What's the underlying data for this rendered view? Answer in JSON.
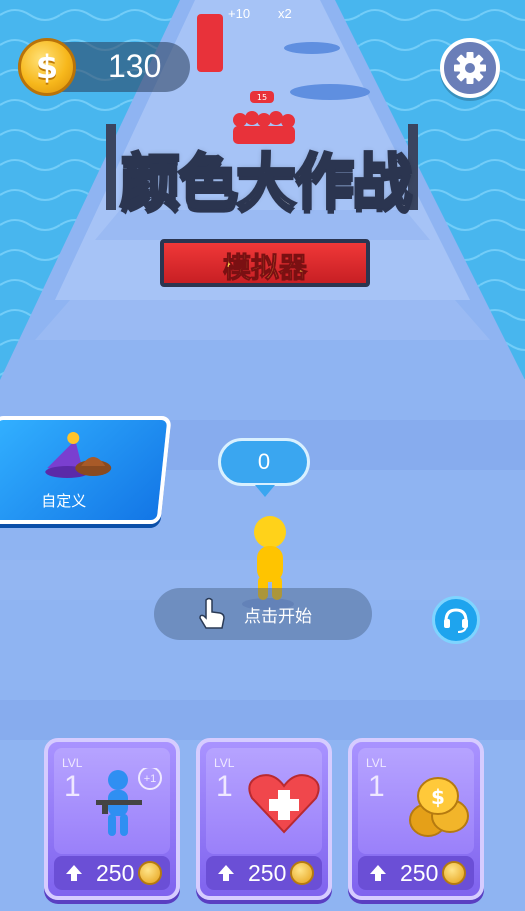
{
  "hud": {
    "coins": "130",
    "coin_symbol": "$"
  },
  "track": {
    "top_bonus_1": "+10",
    "top_bonus_2": "x2",
    "enemy_badge": "15"
  },
  "logo": {
    "title": "颜色大作战",
    "subtitle": "模拟器"
  },
  "customize": {
    "label": "自定义"
  },
  "player": {
    "count": "0"
  },
  "start": {
    "label": "点击开始"
  },
  "upgrades": [
    {
      "lvl_label": "LVL",
      "level": "1",
      "badge": "+1",
      "price": "250",
      "icon": "soldier-gun-icon"
    },
    {
      "lvl_label": "LVL",
      "level": "1",
      "badge": "+",
      "price": "250",
      "icon": "heart-plus-icon"
    },
    {
      "lvl_label": "LVL",
      "level": "1",
      "badge": "$",
      "price": "250",
      "icon": "coin-stack-icon"
    }
  ],
  "colors": {
    "accent": "#1376e6",
    "card": "#8f72f5",
    "player": "#ffd21a",
    "enemy": "#e8323a"
  }
}
